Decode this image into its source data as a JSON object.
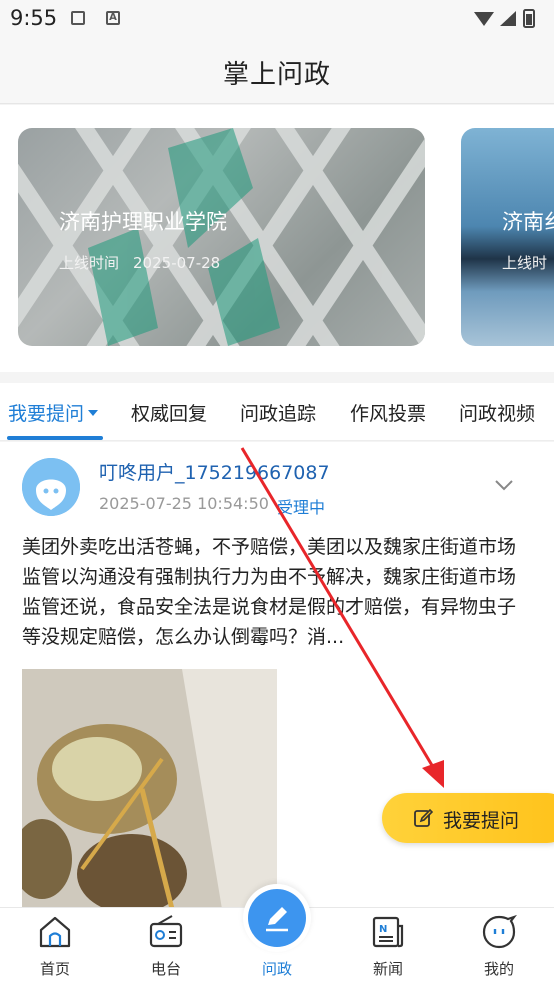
{
  "status_bar": {
    "time": "9:55",
    "icon_b_letter": "A"
  },
  "header": {
    "title": "掌上问政"
  },
  "banners": [
    {
      "title": "济南护理职业学院",
      "meta_label": "上线时间",
      "date": "2025-07-28"
    },
    {
      "title": "济南纟",
      "meta_label": "上线时",
      "date": ""
    }
  ],
  "tabs": [
    {
      "label": "我要提问",
      "active": true
    },
    {
      "label": "权威回复",
      "active": false
    },
    {
      "label": "问政追踪",
      "active": false
    },
    {
      "label": "作风投票",
      "active": false
    },
    {
      "label": "问政视频",
      "active": false
    }
  ],
  "post": {
    "username": "叮咚用户_175219667087",
    "time": "2025-07-25 10:54:50",
    "status": "受理中",
    "body": "美团外卖吃出活苍蝇，不予赔偿，美团以及魏家庄街道市场监管以沟通没有强制执行力为由不予解决，魏家庄街道市场监管还说，食品安全法是说食材是假的才赔偿，有异物虫子等没规定赔偿，怎么办认倒霉吗？消..."
  },
  "ask_button": {
    "label": "我要提问"
  },
  "bottom_nav": [
    {
      "label": "首页",
      "icon": "home-icon",
      "active": false
    },
    {
      "label": "电台",
      "icon": "radio-icon",
      "active": false
    },
    {
      "label": "问政",
      "icon": "pen-icon",
      "active": true
    },
    {
      "label": "新闻",
      "icon": "news-icon",
      "active": false
    },
    {
      "label": "我的",
      "icon": "profile-icon",
      "active": false
    }
  ],
  "colors": {
    "accent": "#1f7ed6",
    "ask_button": "#ffc21a",
    "annotation_arrow": "#e8262a"
  }
}
